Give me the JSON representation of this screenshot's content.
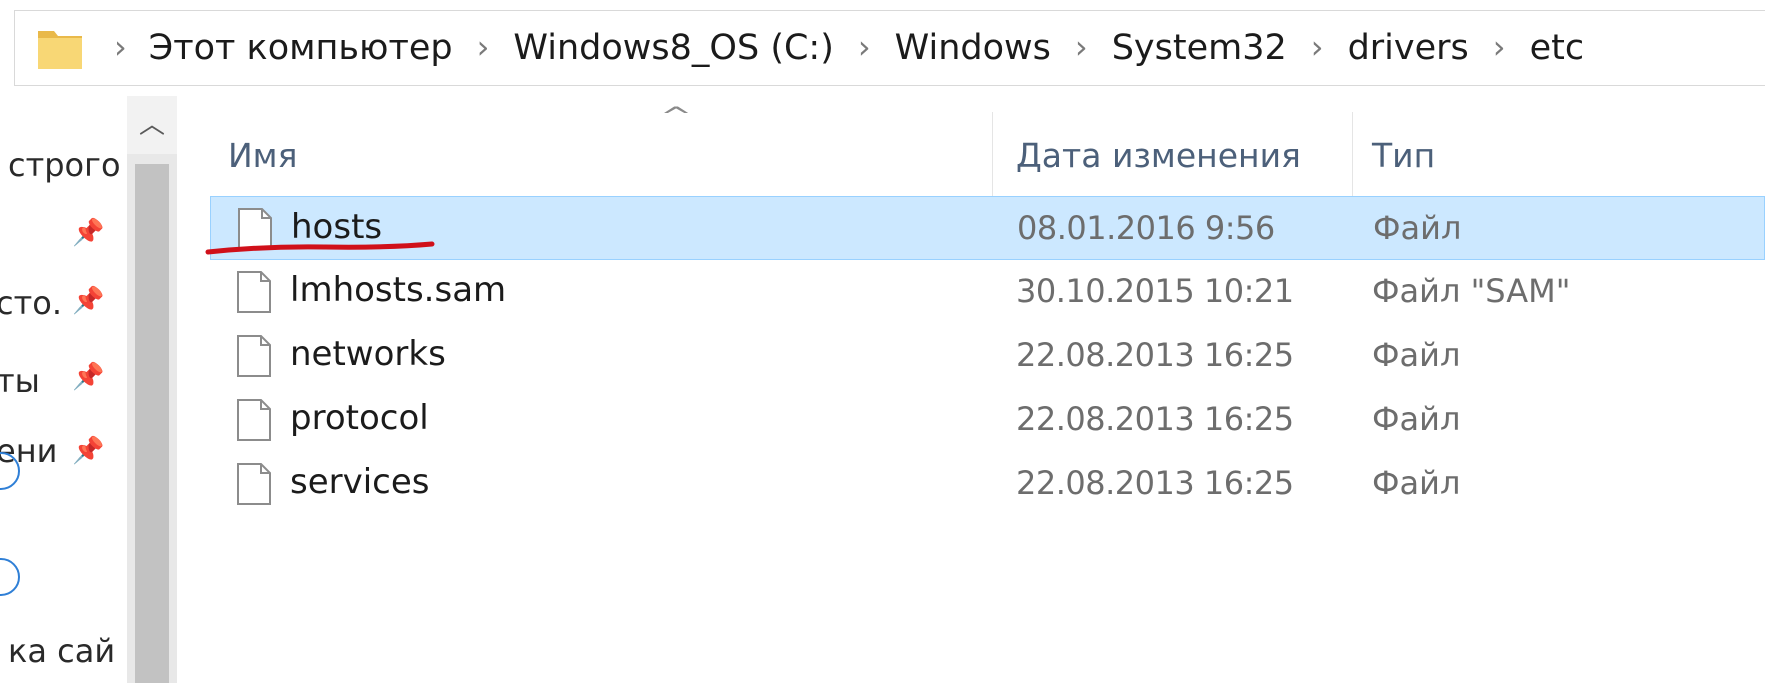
{
  "breadcrumb": [
    "Этот компьютер",
    "Windows8_OS (C:)",
    "Windows",
    "System32",
    "drivers",
    "etc"
  ],
  "columns": {
    "name": "Имя",
    "date": "Дата изменения",
    "type": "Тип"
  },
  "files": [
    {
      "name": "hosts",
      "date": "08.01.2016 9:56",
      "type": "Файл"
    },
    {
      "name": "lmhosts.sam",
      "date": "30.10.2015 10:21",
      "type": "Файл \"SAM\""
    },
    {
      "name": "networks",
      "date": "22.08.2013 16:25",
      "type": "Файл"
    },
    {
      "name": "protocol",
      "date": "22.08.2013 16:25",
      "type": "Файл"
    },
    {
      "name": "services",
      "date": "22.08.2013 16:25",
      "type": "Файл"
    }
  ],
  "nav": {
    "items": [
      "строго",
      "сто.",
      "ты",
      "ени",
      "ка сай"
    ]
  },
  "colors": {
    "selection_bg": "#cce8ff",
    "selection_border": "#99d1ff",
    "header_text": "#4c607a",
    "annotation_red": "#d0101a"
  }
}
